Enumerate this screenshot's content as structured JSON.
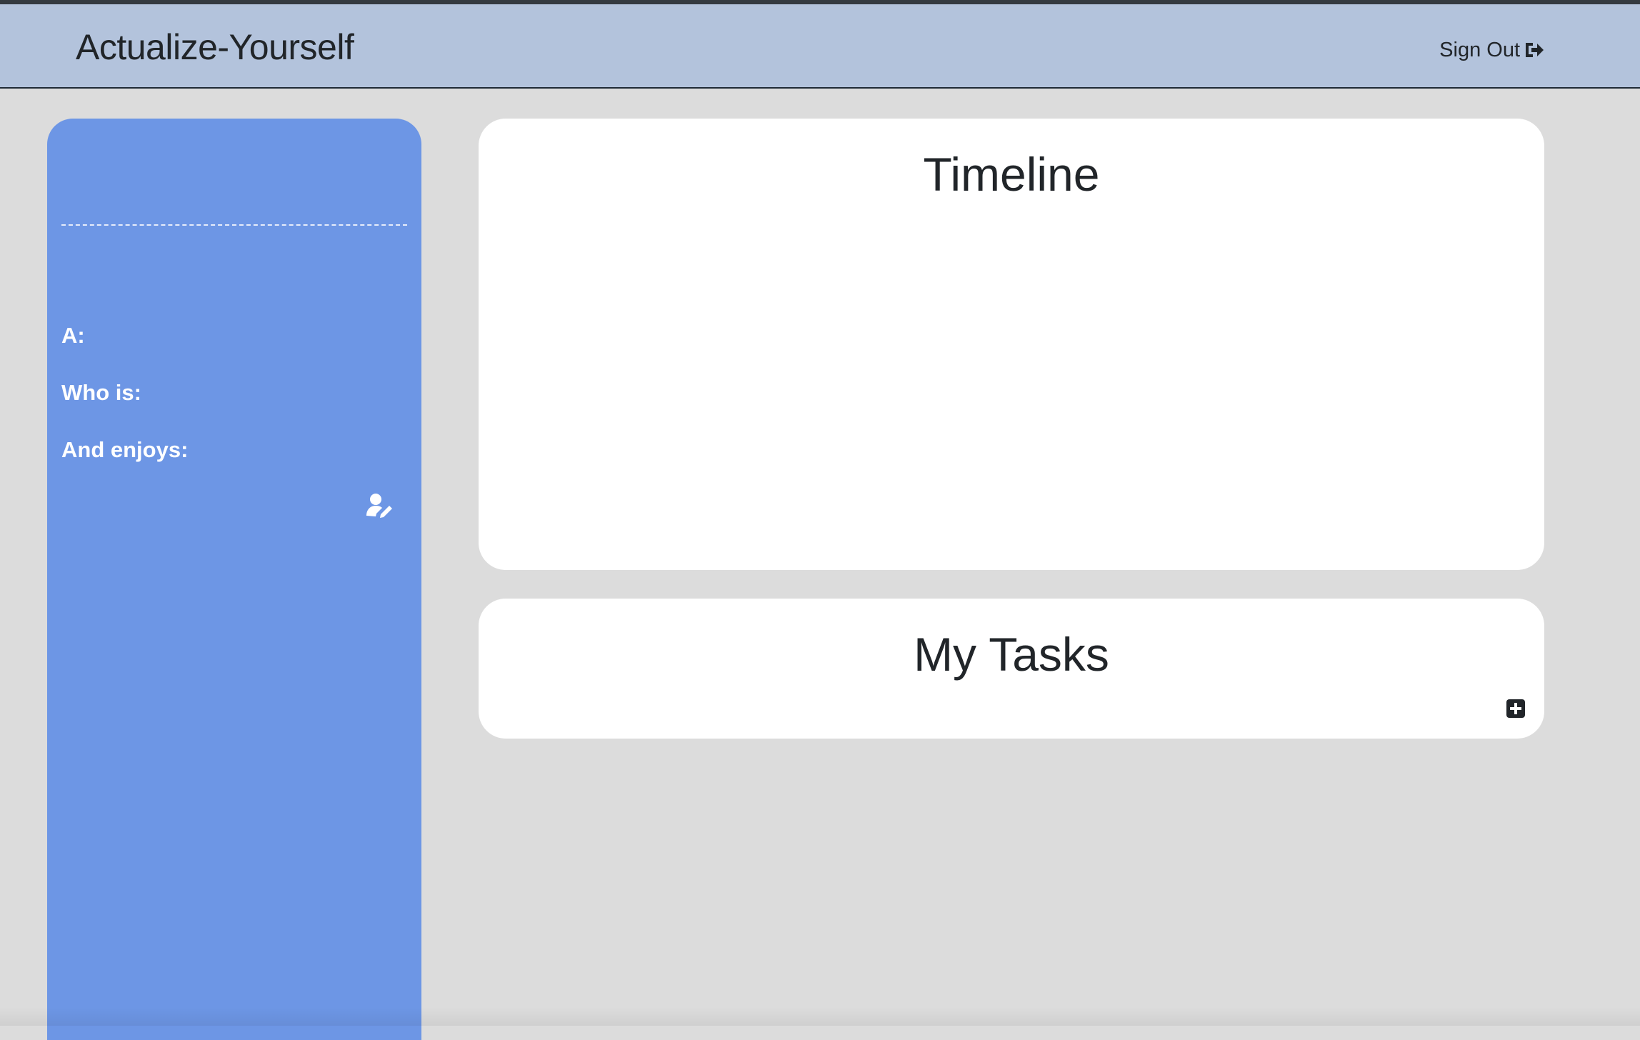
{
  "navbar": {
    "brand": "Actualize-Yourself",
    "signout_label": "Sign Out",
    "signout_icon": "sign-out-icon"
  },
  "sidebar": {
    "labels": {
      "a": "A:",
      "who_is": "Who is:",
      "enjoys": "And enjoys:"
    },
    "edit_icon": "user-edit-icon"
  },
  "timeline": {
    "title": "Timeline"
  },
  "tasks": {
    "title": "My Tasks",
    "add_icon": "plus-square-icon"
  },
  "colors": {
    "navbar_bg": "#b3c3dc",
    "sidebar_bg": "#6d96e5",
    "page_bg": "#dcdcdc",
    "card_bg": "#ffffff",
    "text": "#212529"
  }
}
